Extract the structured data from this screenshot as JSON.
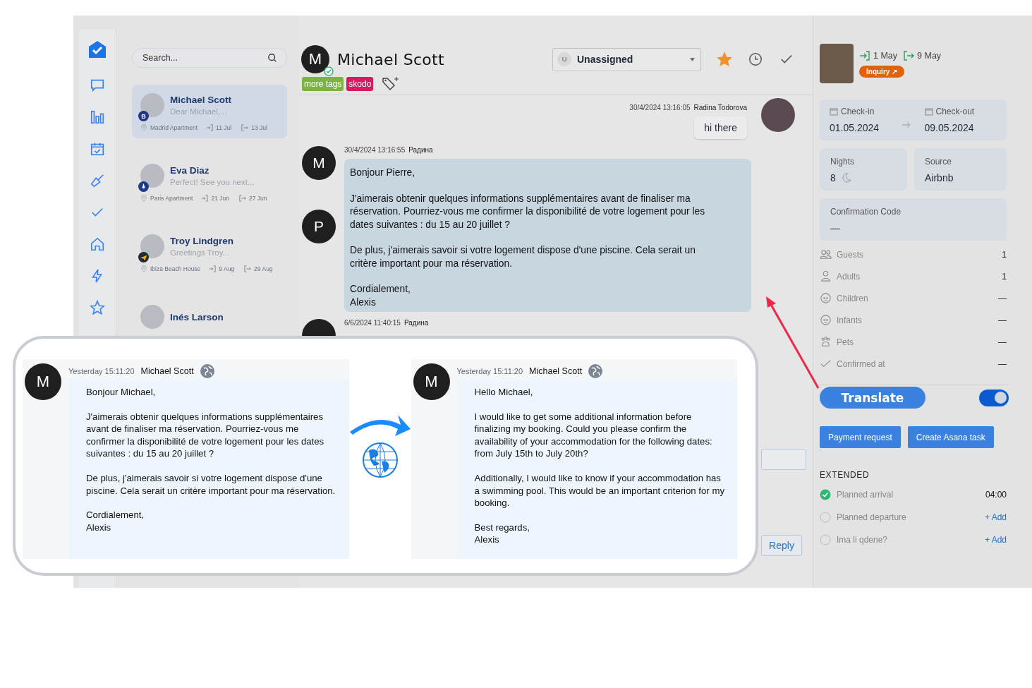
{
  "search": {
    "placeholder": "Search..."
  },
  "conversations": [
    {
      "name": "Michael Scott",
      "preview": "Dear Michael,...",
      "badge": {
        "kind": "letter",
        "text": "B"
      },
      "property": "Madrid Apartment",
      "checkin": "11 Jul",
      "checkout": "13 Jul",
      "selected": true
    },
    {
      "name": "Eva Diaz",
      "preview": "Perfect! See you next...",
      "badge": {
        "kind": "mark"
      },
      "property": "Paris Apartment",
      "checkin": "21 Jun",
      "checkout": "27 Jun",
      "selected": false
    },
    {
      "name": "Troy Lindgren",
      "preview": "Greetings Troy...",
      "badge": {
        "kind": "plane"
      },
      "property": "Ibiza Beach House",
      "checkin": "9 Aug",
      "checkout": "29 Aug",
      "selected": false
    },
    {
      "name": "Inés Larson",
      "selected": false
    }
  ],
  "chat_header": {
    "avatar_letter": "M",
    "verified": true,
    "name": "Michael Scott",
    "assignee": {
      "initial": "U",
      "label": "Unassigned"
    },
    "starred": true,
    "tags": [
      {
        "label": "more tags",
        "color": "#7cb342"
      },
      {
        "label": "skodo",
        "color": "#d81b60"
      }
    ]
  },
  "messages": [
    {
      "kind": "outgoing",
      "time": "30/4/2024 13:16:05",
      "author": "Radina Todorova",
      "paragraphs": [
        "hi there"
      ]
    },
    {
      "kind": "incoming",
      "time": "30/4/2024 13:16:55",
      "author": "Радина",
      "avatars": [
        "M",
        "P"
      ],
      "paragraphs": [
        "Bonjour Pierre,",
        "J'aimerais obtenir quelques informations supplémentaires avant de finaliser ma réservation. Pourriez-vous me confirmer la disponibilité de votre logement pour les dates suivantes : du 15 au 20 juillet ?",
        "De plus, j'aimerais savoir si votre logement dispose d'une piscine. Cela serait un critère important pour ma réservation.",
        "Cordialement,\nAlexis"
      ]
    },
    {
      "kind": "incoming",
      "time": "6/6/2024 11:40:15",
      "author": "Радина"
    }
  ],
  "composer": {
    "reply_label": "Reply"
  },
  "stay": {
    "checkin_short": "1 May",
    "checkout_short": "9 May",
    "status": "Inquiry ↗"
  },
  "dates": {
    "checkin_label": "Check-in",
    "checkin": "01.05.2024",
    "checkout_label": "Check-out",
    "checkout": "09.05.2024"
  },
  "nights": {
    "label": "Nights",
    "value": "8"
  },
  "source": {
    "label": "Source",
    "value": "Airbnb"
  },
  "confirmation": {
    "label": "Confirmation Code",
    "value": "—"
  },
  "guest_rows": [
    {
      "kind": "guests",
      "label": "Guests",
      "value": "1"
    },
    {
      "kind": "adults",
      "label": "Adults",
      "value": "1"
    },
    {
      "kind": "children",
      "label": "Children",
      "value": "—"
    },
    {
      "kind": "infants",
      "label": "Infants",
      "value": "—"
    },
    {
      "kind": "pets",
      "label": "Pets",
      "value": "—"
    },
    {
      "kind": "confirmed",
      "label": "Confirmed at",
      "value": "—"
    }
  ],
  "translate": {
    "label": "Translate",
    "on": true
  },
  "actions": [
    "Payment request",
    "Create Asana task"
  ],
  "extended": {
    "title": "EXTENDED",
    "items": [
      {
        "label": "Planned arrival",
        "checked": true,
        "kind": "value",
        "value": "04:00"
      },
      {
        "label": "Planned departure",
        "checked": false,
        "kind": "add",
        "value": "+ Add"
      },
      {
        "label": "Ima li qdene?",
        "checked": false,
        "kind": "add",
        "value": "+ Add"
      }
    ]
  },
  "translation_callout": {
    "original": {
      "avatar_letter": "M",
      "time": "Yesterday 15:11:20",
      "author": "Michael Scott",
      "paragraphs": [
        "Bonjour Michael,",
        "J'aimerais obtenir quelques informations supplémentaires avant de finaliser ma réservation. Pourriez-vous me confirmer la disponibilité de votre logement pour les dates suivantes : du 15 au 20 juillet ?",
        "De plus, j'aimerais savoir si votre logement dispose d'une piscine. Cela serait un critère important pour ma réservation.",
        "Cordialement,\nAlexis"
      ]
    },
    "translated": {
      "avatar_letter": "M",
      "time": "Yesterday 15:11:20",
      "author": "Michael Scott",
      "paragraphs": [
        "Hello Michael,",
        "I would like to get some additional information before finalizing my booking. Could you please confirm the availability of your accommodation for the following dates: from July 15th to July 20th?",
        "Additionally, I would like to know if your accommodation has a swimming pool. This would be an important criterion for my booking.",
        "Best regards,\nAlexis"
      ]
    }
  }
}
